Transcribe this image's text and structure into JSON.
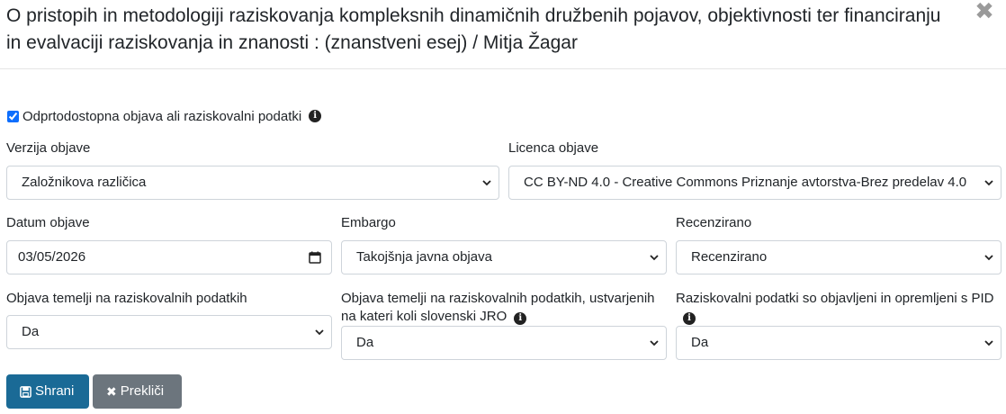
{
  "modal": {
    "title": "O pristopih in metodologiji raziskovanja kompleksnih dinamičnih družbenih pojavov, objektivnosti ter financiranju in evalvaciji raziskovanja in znanosti : (znanstveni esej) / Mitja Žagar",
    "close_icon": "close-icon"
  },
  "form": {
    "open_access_label": "Odprtodostopna objava ali raziskovalni podatki",
    "open_access_checked": true,
    "version_label": "Verzija objave",
    "version_value": "Založnikova različica",
    "license_label": "Licenca objave",
    "license_value": "CC BY-ND 4.0 - Creative Commons Priznanje avtorstva-Brez predelav 4.0",
    "date_label": "Datum objave",
    "date_value": "03/05/2026",
    "embargo_label": "Embargo",
    "embargo_value": "Takojšnja javna objava",
    "reviewed_label": "Recenzirano",
    "reviewed_value": "Recenzirano",
    "based_on_data_label": "Objava temelji na raziskovalnih podatkih",
    "based_on_data_value": "Da",
    "based_on_jro_label": "Objava temelji na raziskovalnih podatkih, ustvarjenih na kateri koli slovenski JRO",
    "based_on_jro_value": "Da",
    "pid_label": "Raziskovalni podatki so objavljeni in opremljeni s PID",
    "pid_value": "Da"
  },
  "actions": {
    "save_label": "Shrani",
    "cancel_label": "Prekliči"
  },
  "colors": {
    "save_button": "#1a6a96",
    "cancel_button": "#6c757d"
  }
}
